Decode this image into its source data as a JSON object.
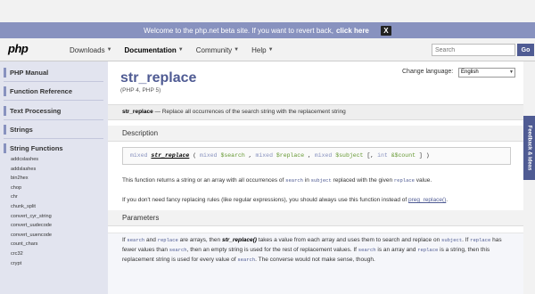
{
  "banner": {
    "text": "Welcome to the php.net beta site. If you want to revert back,",
    "link": "click here",
    "close": "X"
  },
  "header": {
    "logo": "php",
    "nav": [
      {
        "label": "Downloads",
        "caret": "▼"
      },
      {
        "label": "Documentation",
        "caret": "▼"
      },
      {
        "label": "Community",
        "caret": "▼"
      },
      {
        "label": "Help",
        "caret": "▼"
      }
    ],
    "search_placeholder": "Search",
    "go": "Go"
  },
  "sidebar": {
    "sections": [
      "PHP Manual",
      "Function Reference",
      "Text Processing",
      "Strings",
      "String Functions"
    ],
    "functions": [
      "addcslashes",
      "addslashes",
      "bin2hex",
      "chop",
      "chr",
      "chunk_split",
      "convert_cyr_string",
      "convert_uudecode",
      "convert_uuencode",
      "count_chars",
      "crc32",
      "crypt"
    ]
  },
  "content": {
    "change_language": "Change language:",
    "language": "English",
    "refname": "str_replace",
    "version": "(PHP 4, PHP 5)",
    "purpose_name": "str_replace",
    "purpose_text": " — Replace all occurrences of the search string with the replacement string",
    "description_title": "Description",
    "proto": {
      "type1": "mixed",
      "fn": "str_replace",
      "lp": " ( ",
      "type2": "mixed",
      "p1": "$search",
      "c1": " , ",
      "type3": "mixed",
      "p2": "$replace",
      "c2": " , ",
      "type4": "mixed",
      "p3": "$subject",
      "opt": " [, ",
      "type5": "int",
      "p4": "&$count",
      "end": " ] )"
    },
    "desc1_a": "This function returns a string or an array with all occurrences of ",
    "desc1_search": "search",
    "desc1_b": " in ",
    "desc1_subject": "subject",
    "desc1_c": " replaced with the given ",
    "desc1_replace": "replace",
    "desc1_d": " value.",
    "desc2_a": "If you don't need fancy replacing rules (like regular expressions), you should always use this function instead of ",
    "desc2_link": "preg_replace()",
    "desc2_b": ".",
    "parameters_title": "Parameters",
    "par": {
      "a1": "If ",
      "search": "search",
      "a2": " and ",
      "replace": "replace",
      "a3": " are arrays, then ",
      "fn": "str_replace()",
      "a4": " takes a value from each array and uses them to search and replace on ",
      "subject": "subject",
      "a5": ". If ",
      "replace2": "replace",
      "a6": " has fewer values than ",
      "search2": "search",
      "a7": ", then an empty string is used for the rest of replacement values. If ",
      "search3": "search",
      "a8": " is an array and ",
      "replace3": "replace",
      "a9": " is a string, then this replacement string is used for every value of ",
      "search4": "search",
      "a10": ". The converse would not make sense, though."
    }
  },
  "feedback": "Feedback & ideas"
}
